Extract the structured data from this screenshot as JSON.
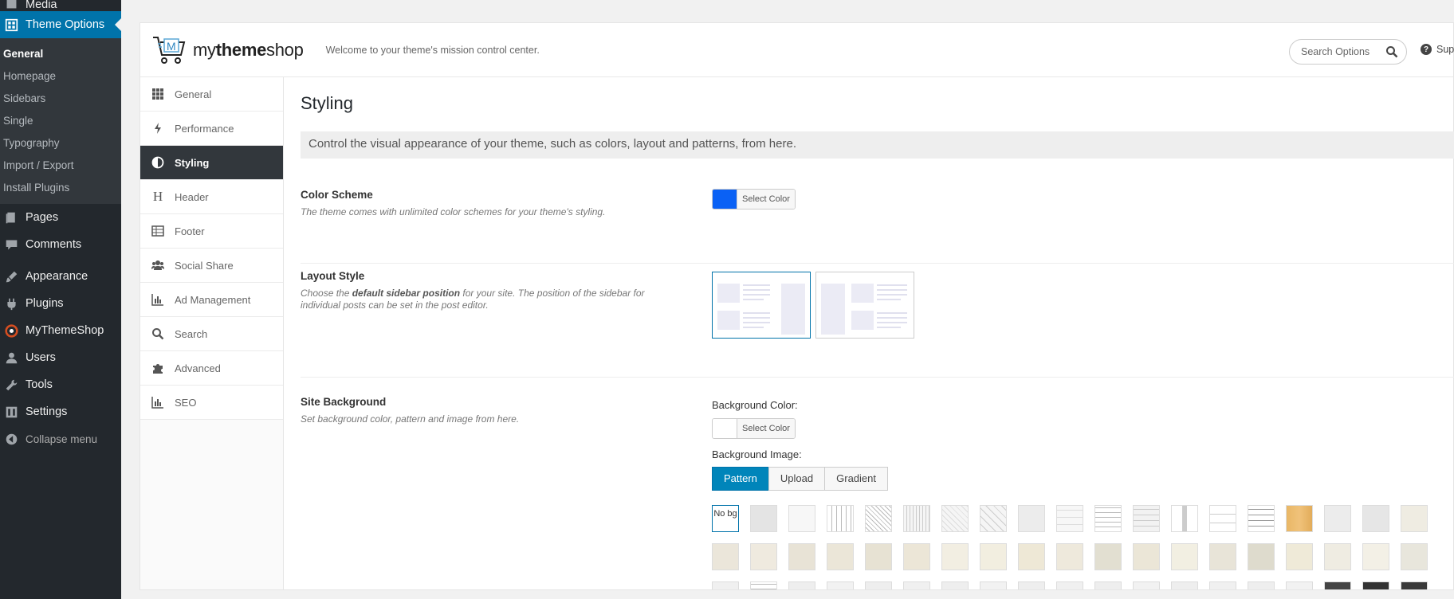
{
  "wp_menu": {
    "top_partial": "Media",
    "theme_options": "Theme Options",
    "submenu": [
      "General",
      "Homepage",
      "Sidebars",
      "Single",
      "Typography",
      "Import / Export",
      "Install Plugins"
    ],
    "items": [
      "Pages",
      "Comments",
      "Appearance",
      "Plugins",
      "MyThemeShop",
      "Users",
      "Tools",
      "Settings"
    ],
    "collapse": "Collapse menu"
  },
  "header": {
    "brand_prefix": "my",
    "brand_bold": "theme",
    "brand_suffix": "shop",
    "welcome": "Welcome to your theme's mission control center.",
    "search_placeholder": "Search Options",
    "support": "Support"
  },
  "tabs": [
    "General",
    "Performance",
    "Styling",
    "Header",
    "Footer",
    "Social Share",
    "Ad Management",
    "Search",
    "Advanced",
    "SEO"
  ],
  "active_tab": "Styling",
  "content": {
    "title": "Styling",
    "description": "Control the visual appearance of your theme, such as colors, layout and patterns, from here.",
    "color_scheme": {
      "label": "Color Scheme",
      "hint": "The theme comes with unlimited color schemes for your theme's styling.",
      "button": "Select Color",
      "color": "#0a61f5"
    },
    "layout_style": {
      "label": "Layout Style",
      "hint_pre": "Choose the ",
      "hint_bold": "default sidebar position",
      "hint_post": " for your site. The position of the sidebar for individual posts can be set in the post editor."
    },
    "site_background": {
      "label": "Site Background",
      "hint": "Set background color, pattern and image from here.",
      "bg_color_label": "Background Color:",
      "bg_color_button": "Select Color",
      "bg_image_label": "Background Image:",
      "segments": [
        "Pattern",
        "Upload",
        "Gradient"
      ],
      "active_segment": "Pattern",
      "no_bg": "No bg"
    }
  }
}
